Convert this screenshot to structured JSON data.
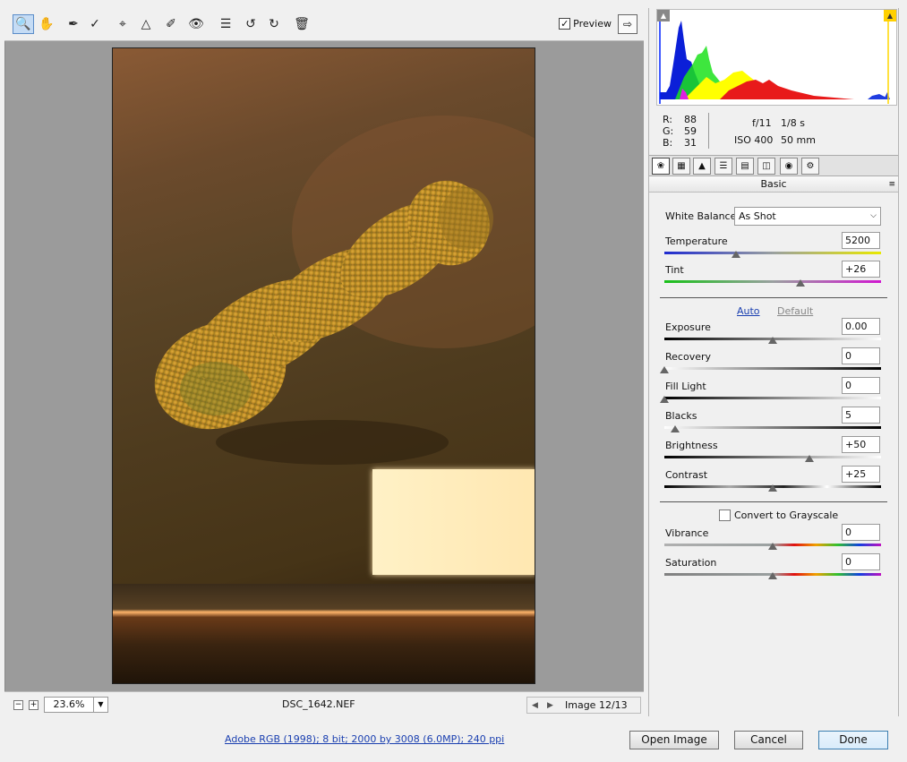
{
  "toolbar": {
    "tools": [
      "zoom-tool",
      "hand-tool",
      "white-balance-tool",
      "color-sampler-tool",
      "crop-tool",
      "straighten-tool",
      "retouch-tool",
      "red-eye-tool",
      "preferences",
      "rotate-left",
      "rotate-right",
      "trash"
    ],
    "preview_label": "Preview",
    "preview_checked": true
  },
  "footer": {
    "zoom_value": "23.6%",
    "zoom_out": "−",
    "zoom_in": "+",
    "filename": "DSC_1642.NEF",
    "image_counter": "Image 12/13",
    "workflow_link": "Adobe RGB (1998); 8 bit; 2000 by 3008 (6.0MP); 240 ppi"
  },
  "info": {
    "r_label": "R:",
    "r_value": "88",
    "g_label": "G:",
    "g_value": "59",
    "b_label": "B:",
    "b_value": "31",
    "aperture": "f/11",
    "shutter": "1/8 s",
    "iso": "ISO 400",
    "focal": "50 mm"
  },
  "panel": {
    "title": "Basic",
    "white_balance_label": "White Balance:",
    "white_balance_value": "As Shot",
    "auto_link": "Auto",
    "default_link": "Default",
    "sliders": [
      {
        "label": "Temperature",
        "value": "5200",
        "level": 0.33
      },
      {
        "label": "Tint",
        "value": "+26",
        "level": 0.63
      },
      {
        "label": "Exposure",
        "value": "0.00",
        "level": 0.5
      },
      {
        "label": "Recovery",
        "value": "0",
        "level": 0.0
      },
      {
        "label": "Fill Light",
        "value": "0",
        "level": 0.0
      },
      {
        "label": "Blacks",
        "value": "5",
        "level": 0.05
      },
      {
        "label": "Brightness",
        "value": "+50",
        "level": 0.67
      },
      {
        "label": "Contrast",
        "value": "+25",
        "level": 0.5
      },
      {
        "label": "Vibrance",
        "value": "0",
        "level": 0.5
      },
      {
        "label": "Saturation",
        "value": "0",
        "level": 0.5
      }
    ],
    "grayscale_label": "Convert to Grayscale"
  },
  "buttons": {
    "open_image": "Open Image",
    "cancel": "Cancel",
    "done": "Done"
  }
}
